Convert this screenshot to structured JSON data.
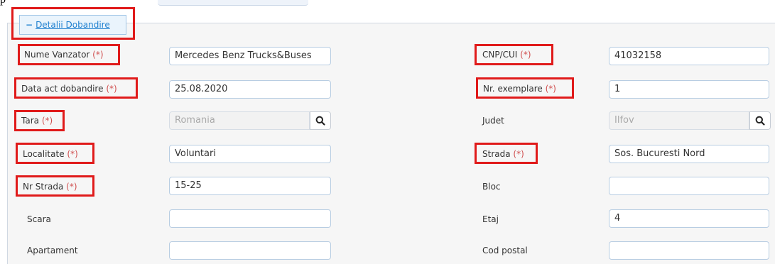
{
  "top_partial_text": "p",
  "section": {
    "toggle": "−",
    "title": "Detalii Dobandire"
  },
  "required_mark": "(*)",
  "fields": {
    "nume_vanzator": {
      "label": "Nume Vanzator",
      "value": "Mercedes Benz Trucks&Buses"
    },
    "cnp_cui": {
      "label": "CNP/CUI",
      "value": "41032158"
    },
    "data_act": {
      "label": "Data act dobandire",
      "value": "25.08.2020"
    },
    "nr_exemplare": {
      "label": "Nr. exemplare",
      "value": "1"
    },
    "tara": {
      "label": "Tara",
      "value": "Romania"
    },
    "judet": {
      "label": "Judet",
      "value": "Ilfov"
    },
    "localitate": {
      "label": "Localitate",
      "value": "Voluntari"
    },
    "strada": {
      "label": "Strada",
      "value": "Sos. Bucuresti Nord"
    },
    "nr_strada": {
      "label": "Nr Strada",
      "value": "15-25"
    },
    "bloc": {
      "label": "Bloc",
      "value": ""
    },
    "scara": {
      "label": "Scara",
      "value": ""
    },
    "etaj": {
      "label": "Etaj",
      "value": "4"
    },
    "apartament": {
      "label": "Apartament",
      "value": ""
    },
    "cod_postal": {
      "label": "Cod postal",
      "value": ""
    }
  },
  "colors": {
    "required": "#d05050",
    "highlight": "#e01a1a",
    "link": "#1d7fcf"
  }
}
